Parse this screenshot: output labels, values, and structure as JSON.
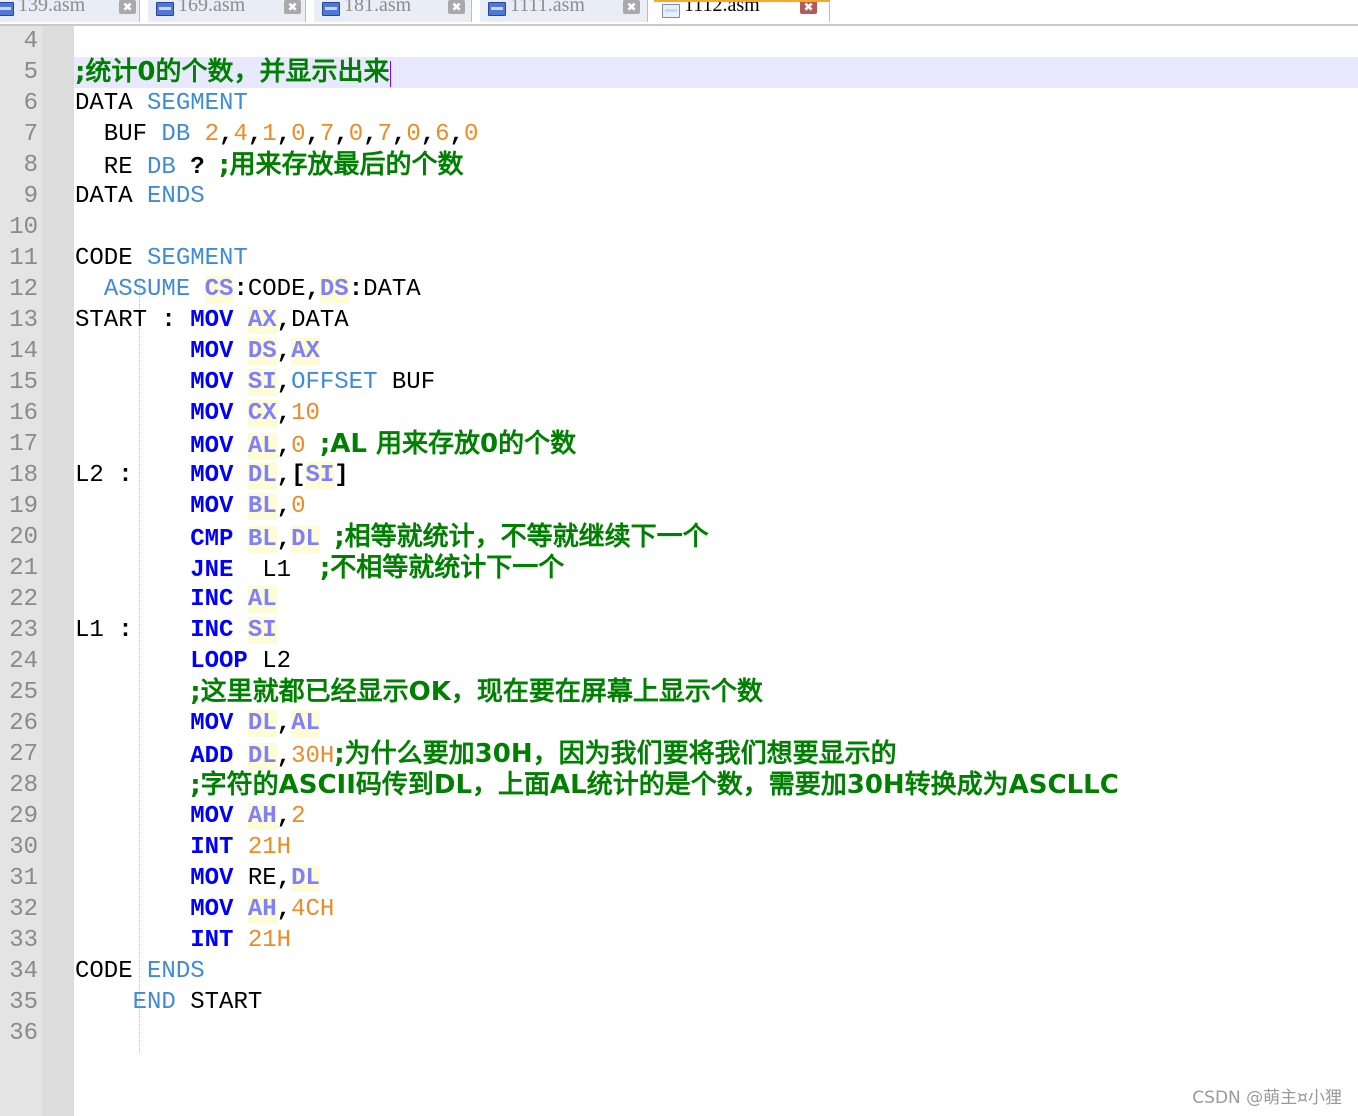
{
  "tabs": [
    {
      "name": "139.asm",
      "active": false
    },
    {
      "name": "169.asm",
      "active": false
    },
    {
      "name": "181.asm",
      "active": false
    },
    {
      "name": "1111.asm",
      "active": false
    },
    {
      "name": "1112.asm",
      "active": true
    }
  ],
  "line_numbers": [
    "4",
    "5",
    "6",
    "7",
    "8",
    "9",
    "10",
    "11",
    "12",
    "13",
    "14",
    "15",
    "16",
    "17",
    "18",
    "19",
    "20",
    "21",
    "22",
    "23",
    "24",
    "25",
    "26",
    "27",
    "28",
    "29",
    "30",
    "31",
    "32",
    "33",
    "34",
    "35",
    "36"
  ],
  "code_lines": [
    [],
    [
      {
        "t": ";统计0的个数，并显示出来",
        "c": "cmt"
      }
    ],
    [
      {
        "t": "DATA ",
        "c": ""
      },
      {
        "t": "SEGMENT",
        "c": "kw"
      }
    ],
    [
      {
        "t": "  BUF ",
        "c": ""
      },
      {
        "t": "DB",
        "c": "kw"
      },
      {
        "t": " ",
        "c": ""
      },
      {
        "t": "2",
        "c": "num"
      },
      {
        "t": ",",
        "c": "punc"
      },
      {
        "t": "4",
        "c": "num"
      },
      {
        "t": ",",
        "c": "punc"
      },
      {
        "t": "1",
        "c": "num"
      },
      {
        "t": ",",
        "c": "punc"
      },
      {
        "t": "0",
        "c": "num"
      },
      {
        "t": ",",
        "c": "punc"
      },
      {
        "t": "7",
        "c": "num"
      },
      {
        "t": ",",
        "c": "punc"
      },
      {
        "t": "0",
        "c": "num"
      },
      {
        "t": ",",
        "c": "punc"
      },
      {
        "t": "7",
        "c": "num"
      },
      {
        "t": ",",
        "c": "punc"
      },
      {
        "t": "0",
        "c": "num"
      },
      {
        "t": ",",
        "c": "punc"
      },
      {
        "t": "6",
        "c": "num"
      },
      {
        "t": ",",
        "c": "punc"
      },
      {
        "t": "0",
        "c": "num"
      }
    ],
    [
      {
        "t": "  RE ",
        "c": ""
      },
      {
        "t": "DB",
        "c": "kw"
      },
      {
        "t": " ",
        "c": ""
      },
      {
        "t": "?",
        "c": "punc"
      },
      {
        "t": " ",
        "c": ""
      },
      {
        "t": ";用来存放最后的个数",
        "c": "cmt"
      }
    ],
    [
      {
        "t": "DATA ",
        "c": ""
      },
      {
        "t": "ENDS",
        "c": "kw"
      }
    ],
    [],
    [
      {
        "t": "CODE ",
        "c": ""
      },
      {
        "t": "SEGMENT",
        "c": "kw"
      }
    ],
    [
      {
        "t": "  ",
        "c": ""
      },
      {
        "t": "ASSUME",
        "c": "kw"
      },
      {
        "t": " ",
        "c": ""
      },
      {
        "t": "CS",
        "c": "reg"
      },
      {
        "t": ":",
        "c": "punc"
      },
      {
        "t": "CODE",
        "c": ""
      },
      {
        "t": ",",
        "c": "punc"
      },
      {
        "t": "DS",
        "c": "reg"
      },
      {
        "t": ":",
        "c": "punc"
      },
      {
        "t": "DATA",
        "c": ""
      }
    ],
    [
      {
        "t": "START ",
        "c": ""
      },
      {
        "t": ":",
        "c": "punc"
      },
      {
        "t": " ",
        "c": ""
      },
      {
        "t": "MOV",
        "c": "op"
      },
      {
        "t": " ",
        "c": ""
      },
      {
        "t": "AX",
        "c": "reg"
      },
      {
        "t": ",",
        "c": "punc"
      },
      {
        "t": "DATA",
        "c": ""
      }
    ],
    [
      {
        "t": "        ",
        "c": ""
      },
      {
        "t": "MOV",
        "c": "op"
      },
      {
        "t": " ",
        "c": ""
      },
      {
        "t": "DS",
        "c": "reg"
      },
      {
        "t": ",",
        "c": "punc"
      },
      {
        "t": "AX",
        "c": "reg"
      }
    ],
    [
      {
        "t": "        ",
        "c": ""
      },
      {
        "t": "MOV",
        "c": "op"
      },
      {
        "t": " ",
        "c": ""
      },
      {
        "t": "SI",
        "c": "reg"
      },
      {
        "t": ",",
        "c": "punc"
      },
      {
        "t": "OFFSET",
        "c": "kw"
      },
      {
        "t": " BUF",
        "c": ""
      }
    ],
    [
      {
        "t": "        ",
        "c": ""
      },
      {
        "t": "MOV",
        "c": "op"
      },
      {
        "t": " ",
        "c": ""
      },
      {
        "t": "CX",
        "c": "reg"
      },
      {
        "t": ",",
        "c": "punc"
      },
      {
        "t": "10",
        "c": "num"
      }
    ],
    [
      {
        "t": "        ",
        "c": ""
      },
      {
        "t": "MOV",
        "c": "op"
      },
      {
        "t": " ",
        "c": ""
      },
      {
        "t": "AL",
        "c": "reg"
      },
      {
        "t": ",",
        "c": "punc"
      },
      {
        "t": "0",
        "c": "num"
      },
      {
        "t": " ",
        "c": ""
      },
      {
        "t": ";AL 用来存放0的个数",
        "c": "cmt"
      }
    ],
    [
      {
        "t": "L2 ",
        "c": ""
      },
      {
        "t": ":",
        "c": "punc"
      },
      {
        "t": "    ",
        "c": ""
      },
      {
        "t": "MOV",
        "c": "op"
      },
      {
        "t": " ",
        "c": ""
      },
      {
        "t": "DL",
        "c": "reg"
      },
      {
        "t": ",",
        "c": "punc"
      },
      {
        "t": "[",
        "c": "punc"
      },
      {
        "t": "SI",
        "c": "reg"
      },
      {
        "t": "]",
        "c": "punc"
      }
    ],
    [
      {
        "t": "        ",
        "c": ""
      },
      {
        "t": "MOV",
        "c": "op"
      },
      {
        "t": " ",
        "c": ""
      },
      {
        "t": "BL",
        "c": "reg"
      },
      {
        "t": ",",
        "c": "punc"
      },
      {
        "t": "0",
        "c": "num"
      }
    ],
    [
      {
        "t": "        ",
        "c": ""
      },
      {
        "t": "CMP",
        "c": "op"
      },
      {
        "t": " ",
        "c": ""
      },
      {
        "t": "BL",
        "c": "reg"
      },
      {
        "t": ",",
        "c": "punc"
      },
      {
        "t": "DL",
        "c": "reg"
      },
      {
        "t": " ",
        "c": ""
      },
      {
        "t": ";相等就统计，不等就继续下一个",
        "c": "cmt"
      }
    ],
    [
      {
        "t": "        ",
        "c": ""
      },
      {
        "t": "JNE",
        "c": "op"
      },
      {
        "t": "  L1  ",
        "c": ""
      },
      {
        "t": ";不相等就统计下一个",
        "c": "cmt"
      }
    ],
    [
      {
        "t": "        ",
        "c": ""
      },
      {
        "t": "INC",
        "c": "op"
      },
      {
        "t": " ",
        "c": ""
      },
      {
        "t": "AL",
        "c": "reg"
      }
    ],
    [
      {
        "t": "L1 ",
        "c": ""
      },
      {
        "t": ":",
        "c": "punc"
      },
      {
        "t": "    ",
        "c": ""
      },
      {
        "t": "INC",
        "c": "op"
      },
      {
        "t": " ",
        "c": ""
      },
      {
        "t": "SI",
        "c": "reg"
      }
    ],
    [
      {
        "t": "        ",
        "c": ""
      },
      {
        "t": "LOOP",
        "c": "op"
      },
      {
        "t": " L2",
        "c": ""
      }
    ],
    [
      {
        "t": "        ",
        "c": ""
      },
      {
        "t": ";这里就都已经显示OK，现在要在屏幕上显示个数",
        "c": "cmt"
      }
    ],
    [
      {
        "t": "        ",
        "c": ""
      },
      {
        "t": "MOV",
        "c": "op"
      },
      {
        "t": " ",
        "c": ""
      },
      {
        "t": "DL",
        "c": "reg"
      },
      {
        "t": ",",
        "c": "punc"
      },
      {
        "t": "AL",
        "c": "reg"
      }
    ],
    [
      {
        "t": "        ",
        "c": ""
      },
      {
        "t": "ADD",
        "c": "op"
      },
      {
        "t": " ",
        "c": ""
      },
      {
        "t": "DL",
        "c": "reg"
      },
      {
        "t": ",",
        "c": "punc"
      },
      {
        "t": "30H",
        "c": "num"
      },
      {
        "t": ";为什么要加30H，因为我们要将我们想要显示的",
        "c": "cmt"
      }
    ],
    [
      {
        "t": "        ",
        "c": ""
      },
      {
        "t": ";字符的ASCII码传到DL，上面AL统计的是个数，需要加30H转换成为ASCLLC",
        "c": "cmt"
      }
    ],
    [
      {
        "t": "        ",
        "c": ""
      },
      {
        "t": "MOV",
        "c": "op"
      },
      {
        "t": " ",
        "c": ""
      },
      {
        "t": "AH",
        "c": "reg"
      },
      {
        "t": ",",
        "c": "punc"
      },
      {
        "t": "2",
        "c": "num"
      }
    ],
    [
      {
        "t": "        ",
        "c": ""
      },
      {
        "t": "INT",
        "c": "op"
      },
      {
        "t": " ",
        "c": ""
      },
      {
        "t": "21H",
        "c": "num"
      }
    ],
    [
      {
        "t": "        ",
        "c": ""
      },
      {
        "t": "MOV",
        "c": "op"
      },
      {
        "t": " RE",
        "c": ""
      },
      {
        "t": ",",
        "c": "punc"
      },
      {
        "t": "DL",
        "c": "reg"
      }
    ],
    [
      {
        "t": "        ",
        "c": ""
      },
      {
        "t": "MOV",
        "c": "op"
      },
      {
        "t": " ",
        "c": ""
      },
      {
        "t": "AH",
        "c": "reg"
      },
      {
        "t": ",",
        "c": "punc"
      },
      {
        "t": "4CH",
        "c": "num"
      }
    ],
    [
      {
        "t": "        ",
        "c": ""
      },
      {
        "t": "INT",
        "c": "op"
      },
      {
        "t": " ",
        "c": ""
      },
      {
        "t": "21H",
        "c": "num"
      }
    ],
    [
      {
        "t": "CODE ",
        "c": ""
      },
      {
        "t": "ENDS",
        "c": "kw"
      }
    ],
    [
      {
        "t": "    ",
        "c": ""
      },
      {
        "t": "END",
        "c": "kw"
      },
      {
        "t": " START",
        "c": ""
      }
    ],
    []
  ],
  "watermark": "CSDN @萌主¤小狸",
  "colors": {
    "opcode": "#0000ff",
    "register": "#8080ff",
    "directive": "#3f8bd9",
    "number": "#f08a24",
    "comment": "#008000",
    "current_line": "#e8e8ff"
  }
}
